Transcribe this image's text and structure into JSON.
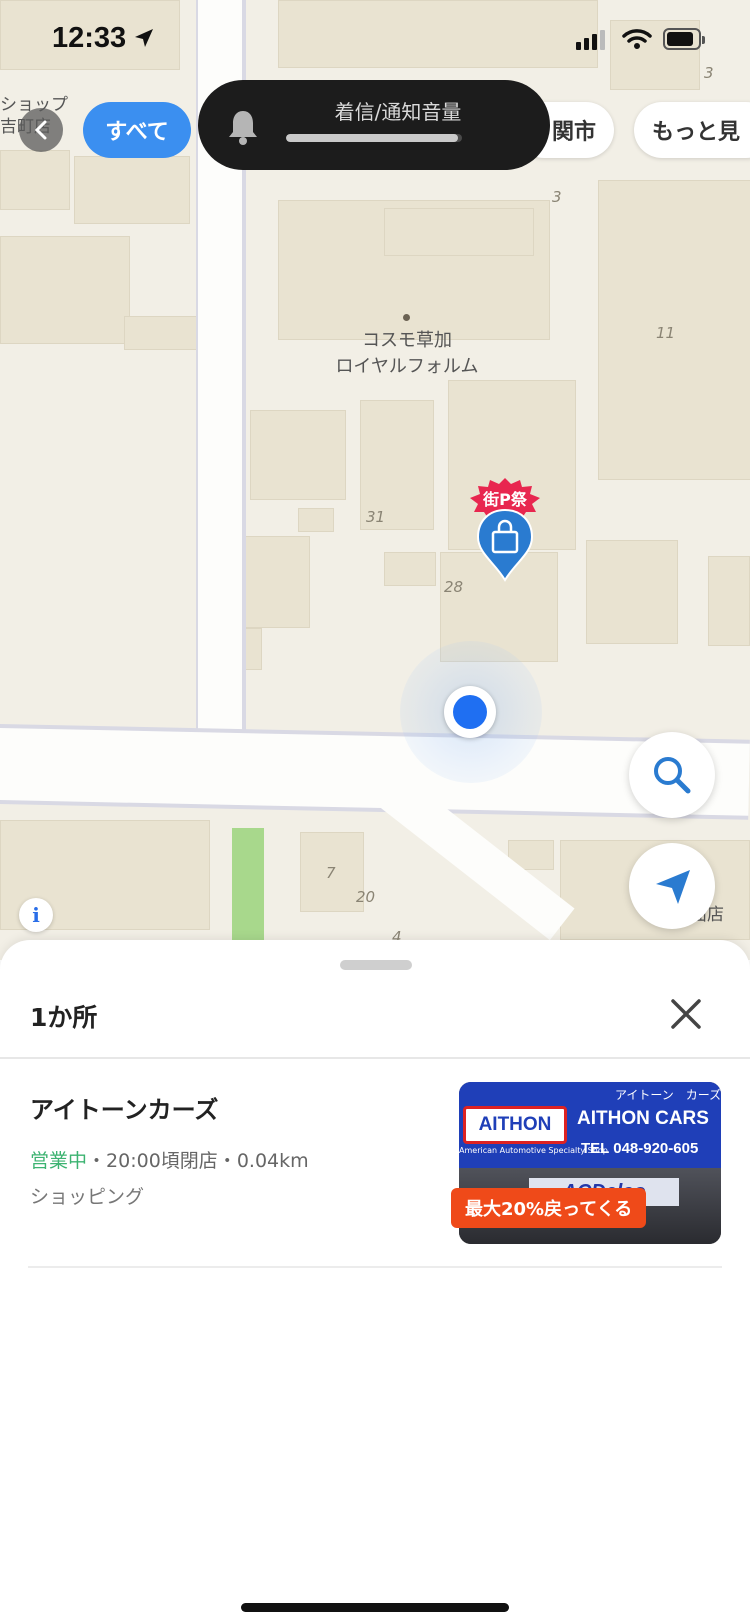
{
  "status_bar": {
    "time": "12:33",
    "location_icon": "location-arrow-icon",
    "signal_icon": "cellular-signal-icon",
    "wifi_icon": "wifi-icon",
    "battery_icon": "battery-icon"
  },
  "categories": {
    "back_icon": "chevron-left-icon",
    "items": [
      {
        "label": "すべて",
        "selected": true
      },
      {
        "label": "関市",
        "selected": false
      },
      {
        "label": "もっと見",
        "selected": false
      }
    ]
  },
  "volume_hud": {
    "icon": "bell-icon",
    "label": "着信/通知音量",
    "level": 0.98
  },
  "map": {
    "labels": {
      "left_shop_line1": "ショップ",
      "left_shop_line2": "吉町店",
      "poi_line1": "コスモ草加",
      "poi_line2": "ロイヤルフォルム",
      "right_shop": "面店"
    },
    "block_numbers": [
      "3",
      "3",
      "11",
      "31",
      "28",
      "7",
      "20",
      "4"
    ],
    "pin_badge": "街P祭",
    "pin_icon": "shopping-bag-icon",
    "search_icon": "search-icon",
    "navigate_icon": "navigation-arrow-icon",
    "info_label": "i"
  },
  "sheet": {
    "count": "1か所",
    "close_icon": "close-icon",
    "place": {
      "name": "アイトーンカーズ",
      "status": "営業中",
      "separator": "・",
      "hours": "20:00頃閉店",
      "distance": "0.04km",
      "category": "ショッピング",
      "photo": {
        "kana": "アイトーン　カーズ",
        "logo": "AITHON",
        "brand": "AITHON CARS",
        "specialty": "American Automotive Specialty Shop",
        "tel": "TEL 048-920-605",
        "lower_sign": "ACDelco"
      },
      "promo": "最大20%戻ってくる"
    }
  },
  "colors": {
    "accent": "#3b8ff0",
    "open_status": "#3cb371",
    "promo": "#ef4a19",
    "pin": "#2a7bd0",
    "badge": "#e8264f"
  }
}
